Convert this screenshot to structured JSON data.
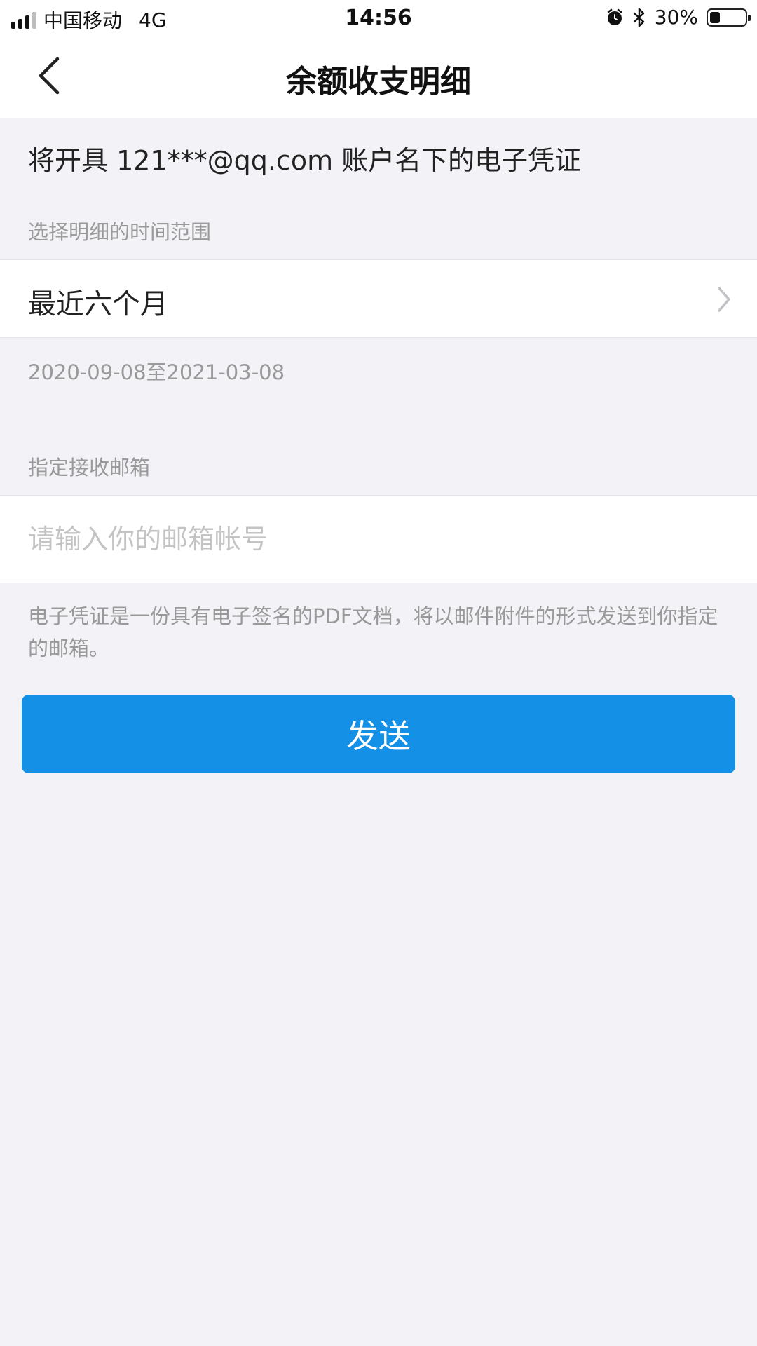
{
  "status_bar": {
    "carrier": "中国移动",
    "network": "4G",
    "time": "14:56",
    "battery_text": "30%",
    "battery_level": 0.3,
    "icons": [
      "signal-icon",
      "alarm-icon",
      "bluetooth-icon",
      "battery-icon"
    ]
  },
  "nav": {
    "back_icon": "chevron-left-icon",
    "title": "余额收支明细"
  },
  "form": {
    "notice_title": "将开具 121***@qq.com 账户名下的电子凭证",
    "range_label": "选择明细的时间范围",
    "range_value": "最近六个月",
    "range_chevron_icon": "chevron-right-icon",
    "date_range": "2020-09-08至2021-03-08",
    "email_label": "指定接收邮箱",
    "email_value": "",
    "email_placeholder": "请输入你的邮箱帐号",
    "description": "电子凭证是一份具有电子签名的PDF文档，将以邮件附件的形式发送到你指定的邮箱。",
    "send_label": "发送"
  },
  "colors": {
    "background": "#f2f2f7",
    "primary": "#1490e6",
    "label_gray": "#999999",
    "placeholder_gray": "#c4c4c4"
  }
}
